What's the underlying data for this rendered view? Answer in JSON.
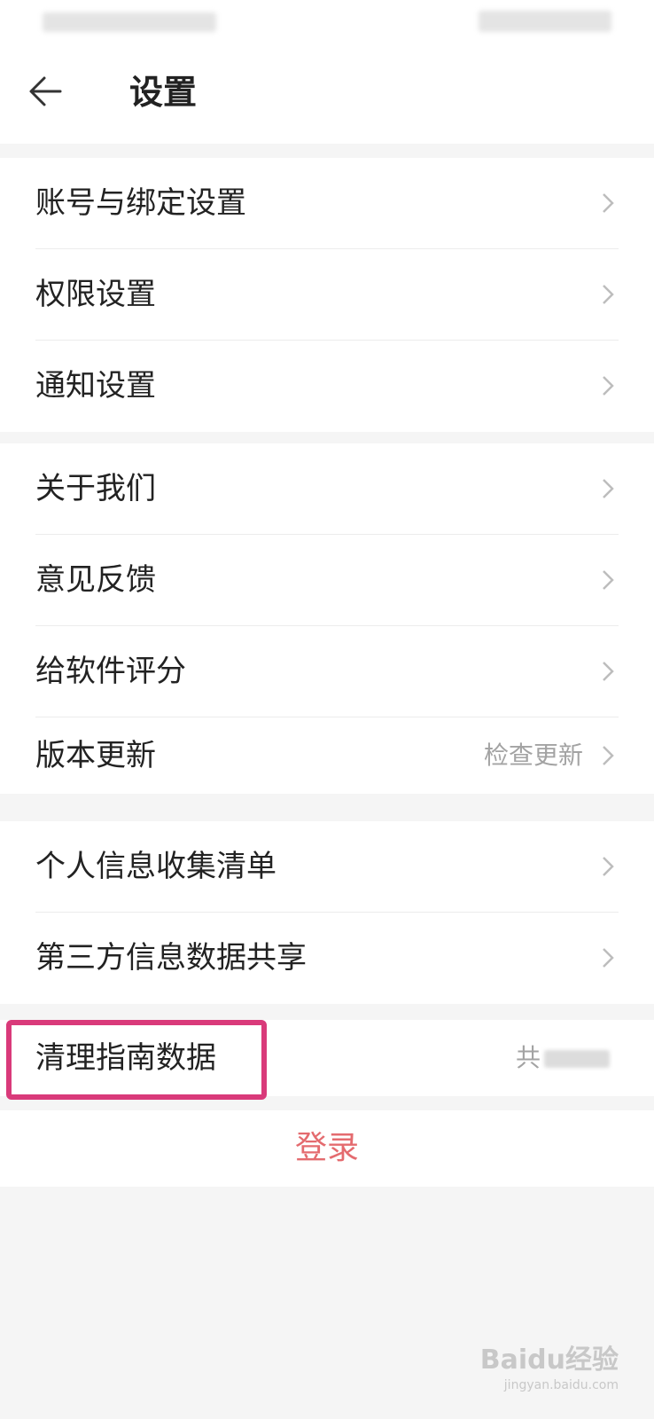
{
  "header": {
    "title": "设置"
  },
  "groups": [
    {
      "items": [
        {
          "label": "账号与绑定设置"
        },
        {
          "label": "权限设置"
        },
        {
          "label": "通知设置"
        }
      ]
    },
    {
      "items": [
        {
          "label": "关于我们"
        },
        {
          "label": "意见反馈"
        },
        {
          "label": "给软件评分"
        },
        {
          "label": "版本更新",
          "value": "检查更新"
        }
      ]
    },
    {
      "items": [
        {
          "label": "个人信息收集清单"
        },
        {
          "label": "第三方信息数据共享"
        }
      ]
    },
    {
      "items": [
        {
          "label": "清理指南数据",
          "value": "共"
        }
      ]
    }
  ],
  "login": {
    "label": "登录"
  },
  "watermark": {
    "text": "Baidu经验",
    "sub": "jingyan.baidu.com"
  },
  "colors": {
    "highlight": "#d93a7a",
    "login": "#e46b6f"
  }
}
